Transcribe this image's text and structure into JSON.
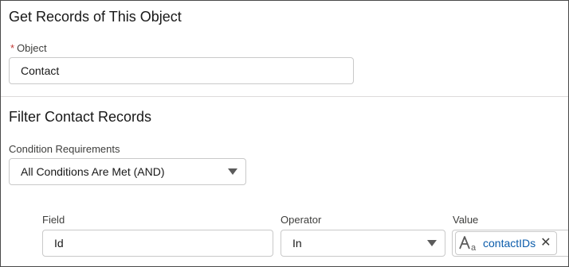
{
  "section1": {
    "title": "Get Records of This Object",
    "object_field": {
      "required_marker": "*",
      "label": "Object",
      "value": "Contact"
    }
  },
  "section2": {
    "title": "Filter Contact Records",
    "condition": {
      "label": "Condition Requirements",
      "value": "All Conditions Are Met (AND)"
    },
    "filter_row": {
      "field_label": "Field",
      "field_value": "Id",
      "operator_label": "Operator",
      "operator_value": "In",
      "value_label": "Value",
      "value_pill": "contactIDs"
    }
  },
  "icons": {
    "text_type": "text-type-icon",
    "clear": "close-icon",
    "dropdown": "chevron-down-icon"
  },
  "colors": {
    "required": "#c23934",
    "link": "#0b5cab",
    "border": "#c9c9c9"
  }
}
